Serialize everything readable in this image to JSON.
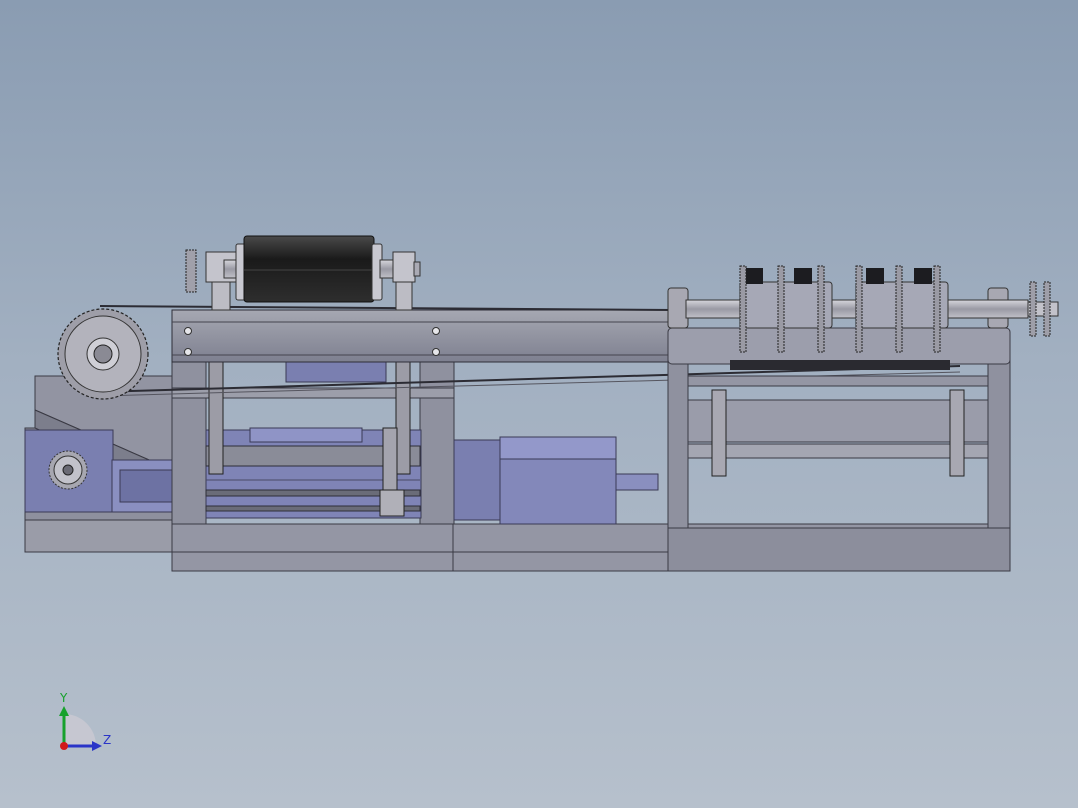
{
  "viewport": {
    "background_top": "#8a9cb2",
    "background_bottom": "#b6c0cc"
  },
  "model": {
    "frame_color": "#8f919f",
    "motor_color": "#7a7fb0",
    "roller_color": "#1e1e1e",
    "metal_color": "#b9b9c1"
  },
  "triad": {
    "y_label": "Y",
    "z_label": "Z",
    "y_color": "#17a12c",
    "z_color": "#2a34c8",
    "x_color": "#d01a1a"
  }
}
